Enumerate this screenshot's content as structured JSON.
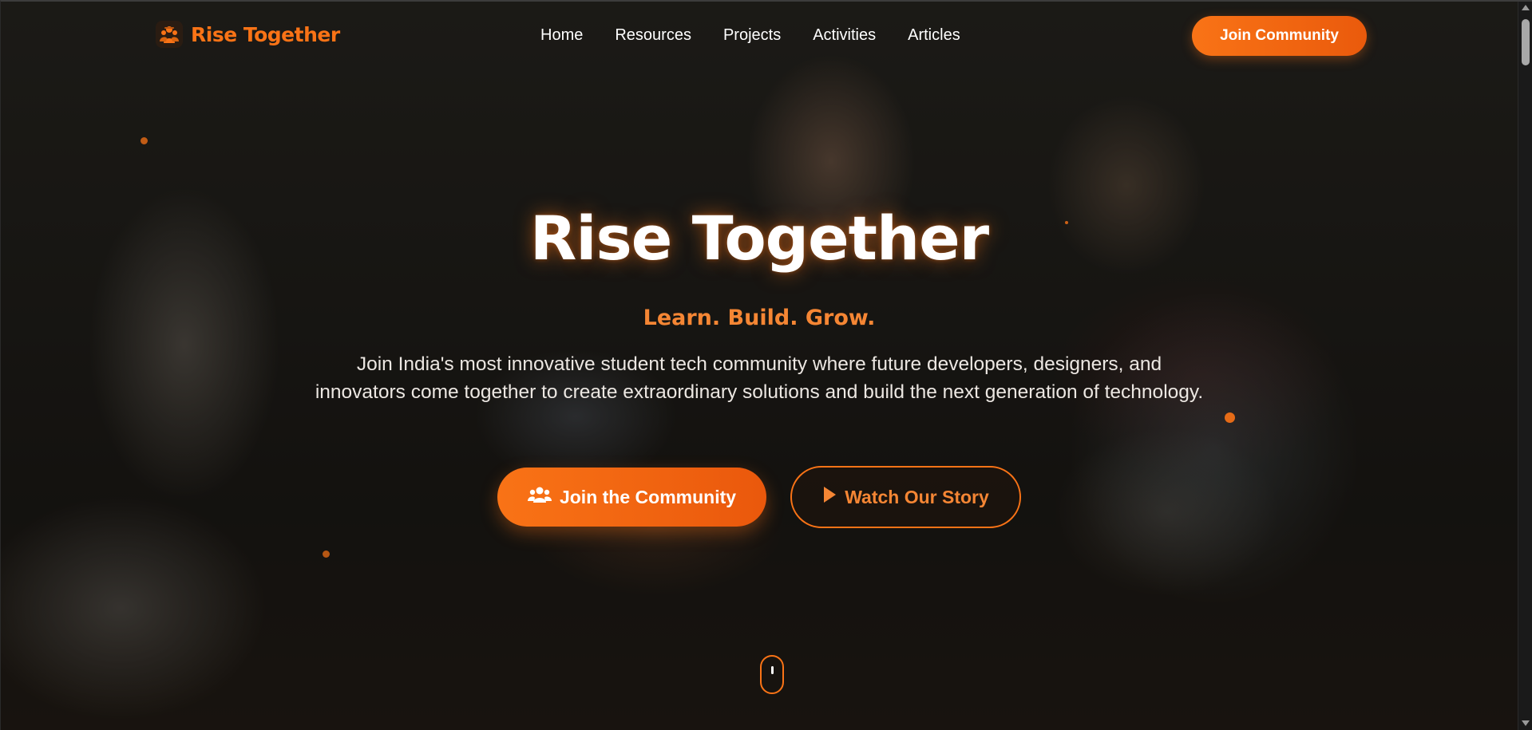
{
  "navbar": {
    "brand_name": "Rise Together",
    "brand_icon": "team-icon",
    "links": [
      {
        "label": "Home"
      },
      {
        "label": "Resources"
      },
      {
        "label": "Projects"
      },
      {
        "label": "Activities"
      },
      {
        "label": "Articles"
      }
    ],
    "cta_label": "Join Community"
  },
  "hero": {
    "title": "Rise Together",
    "tagline": "Learn. Build. Grow.",
    "description": "Join India's most innovative student tech community where future developers, designers, and innovators come together to create extraordinary solutions and build the next generation of technology.",
    "primary_button": {
      "label": "Join the Community",
      "icon": "users-icon"
    },
    "secondary_button": {
      "label": "Watch Our Story",
      "icon": "play-icon"
    }
  },
  "colors": {
    "accent": "#f97316",
    "accent_dark": "#ea580c",
    "text": "#ffffff"
  }
}
